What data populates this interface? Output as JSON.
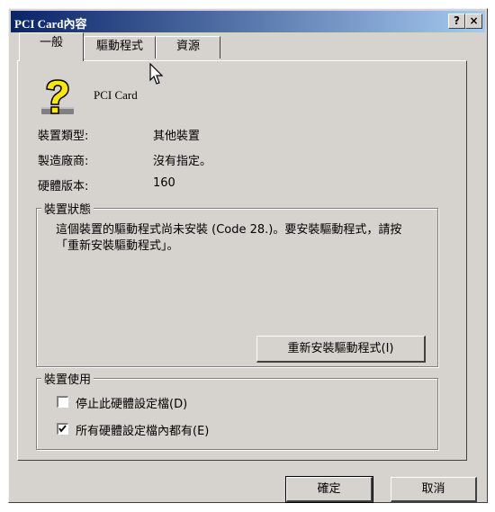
{
  "window": {
    "title": "PCI Card內容",
    "help_btn": "?",
    "close_btn": "×"
  },
  "tabs": [
    {
      "label": "一般",
      "active": true
    },
    {
      "label": "驅動程式",
      "active": false
    },
    {
      "label": "資源",
      "active": false
    }
  ],
  "device": {
    "name": "PCI Card",
    "icon": "question-mark-icon"
  },
  "props": [
    {
      "label": "裝置類型:",
      "value": "其他裝置"
    },
    {
      "label": "製造廠商:",
      "value": "沒有指定。"
    },
    {
      "label": "硬體版本:",
      "value": "160"
    }
  ],
  "status": {
    "title": "裝置狀態",
    "text": "這個裝置的驅動程式尚未安裝 (Code 28.)。要安裝驅動程式，請按「重新安裝驅動程式」。",
    "reinstall_btn": "重新安裝驅動程式(I)"
  },
  "usage": {
    "title": "裝置使用",
    "options": [
      {
        "label": "停止此硬體設定檔(D)",
        "checked": false
      },
      {
        "label": "所有硬體設定檔內都有(E)",
        "checked": true
      }
    ]
  },
  "buttons": {
    "ok": "確定",
    "cancel": "取消"
  }
}
